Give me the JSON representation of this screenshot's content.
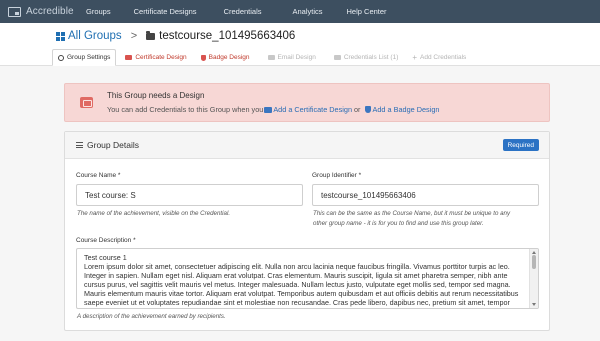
{
  "navbar": {
    "brand": "Accredible",
    "items": [
      "Groups",
      "Certificate Designs",
      "Credentials",
      "Analytics",
      "Help Center"
    ]
  },
  "breadcrumb": {
    "all_groups": "All Groups",
    "separator": ">",
    "current": "testcourse_101495663406"
  },
  "tabs": [
    {
      "label": "Group Settings",
      "icon": "gear-icon",
      "state": "active"
    },
    {
      "label": "Certificate Design",
      "icon": "certificate-icon",
      "state": "warning"
    },
    {
      "label": "Badge Design",
      "icon": "badge-icon",
      "state": "warning"
    },
    {
      "label": "Email Design",
      "icon": "email-icon",
      "state": "disabled"
    },
    {
      "label": "Credentials List (1)",
      "icon": "list-icon",
      "state": "disabled"
    },
    {
      "label": "Add Credentials",
      "icon": "plus-icon",
      "state": "disabled"
    }
  ],
  "alert": {
    "title": "This Group needs a Design",
    "text_before": "You can add Credentials to this Group when you",
    "link_certificate": "Add a Certificate Design",
    "text_or": "or",
    "link_badge": "Add a Badge Design",
    "background": "#f7d7d5"
  },
  "panel": {
    "title": "Group Details",
    "required_badge": "Required",
    "course_name": {
      "label": "Course Name *",
      "value": "Test course: S",
      "help": "The name of the achievement, visible on the Credential."
    },
    "group_identifier": {
      "label": "Group Identifier *",
      "value": "testcourse_101495663406",
      "help_line1": "This can be the same as the Course Name, but it must be unique to any",
      "help_line2": "other group name - it is for you to find and use this group later."
    },
    "course_description": {
      "label": "Course Description *",
      "value": "Test course 1\nLorem ipsum dolor sit amet, consectetuer adipiscing elit. Nulla non arcu lacinia neque faucibus fringilla. Vivamus porttitor turpis ac leo. Integer in sapien. Nullam eget nisl. Aliquam erat volutpat. Cras elementum. Mauris suscipit, ligula sit amet pharetra semper, nibh ante cursus purus, vel sagittis velit mauris vel metus. Integer malesuada. Nullam lectus justo, vulputate eget mollis sed, tempor sed magna. Mauris elementum mauris vitae tortor. Aliquam erat volutpat. Temporibus autem quibusdam et aut officiis debitis aut rerum necessitatibus saepe eveniet ut et voluptates repudiandae sint et molestiae non recusandae. Cras pede libero, dapibus nec, pretium sit amet, tempor quis.",
      "help": "A description of the achievement earned by recipients."
    }
  },
  "colors": {
    "navbar": "#3d4f60",
    "link": "#1f6fb2",
    "warning": "#c0392b",
    "required": "#2b72c4"
  }
}
